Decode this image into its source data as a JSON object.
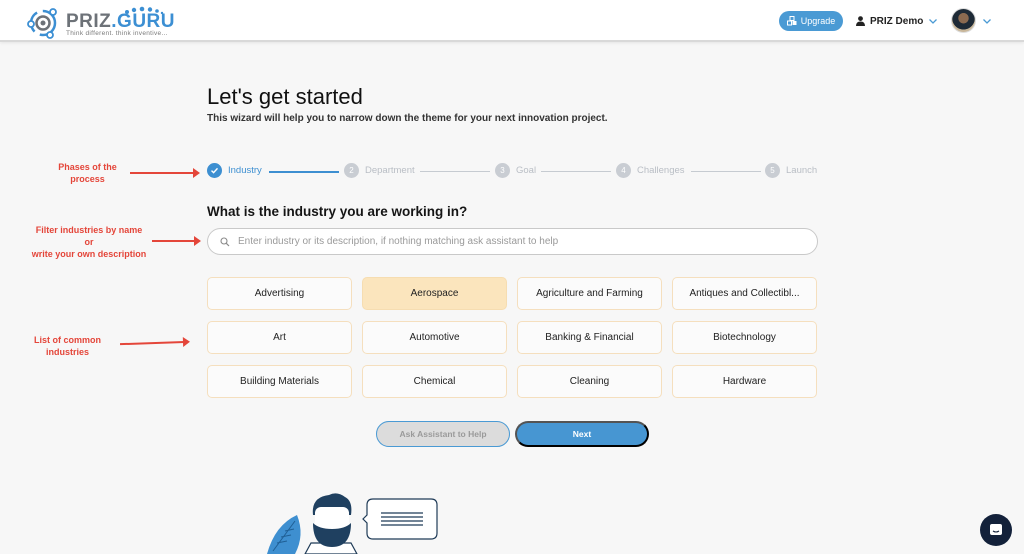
{
  "header": {
    "logo": {
      "brand_part1": "PRIZ",
      "brand_part2": ".GURU",
      "tagline": "Think different. think inventive..."
    },
    "upgrade_label": "Upgrade",
    "user_name": "PRIZ Demo",
    "icons": {
      "upgrade": "cubes-icon",
      "user": "user-icon",
      "chevron": "chevron-down-icon",
      "avatar": "avatar"
    }
  },
  "page": {
    "title": "Let's get started",
    "subtitle": "This wizard will help you to narrow down the theme for your next innovation project."
  },
  "stepper": {
    "steps": [
      {
        "number": "✓",
        "label": "Industry",
        "state": "active"
      },
      {
        "number": "2",
        "label": "Department",
        "state": "inactive"
      },
      {
        "number": "3",
        "label": "Goal",
        "state": "inactive"
      },
      {
        "number": "4",
        "label": "Challenges",
        "state": "inactive"
      },
      {
        "number": "5",
        "label": "Launch",
        "state": "inactive"
      }
    ]
  },
  "question": "What is the industry you are working in?",
  "search": {
    "value": "",
    "placeholder": "Enter industry or its description, if nothing matching ask assistant to help"
  },
  "industries": [
    {
      "label": "Advertising",
      "selected": false
    },
    {
      "label": "Aerospace",
      "selected": true
    },
    {
      "label": "Agriculture and Farming",
      "selected": false
    },
    {
      "label": "Antiques and Collectibl...",
      "selected": false
    },
    {
      "label": "Art",
      "selected": false
    },
    {
      "label": "Automotive",
      "selected": false
    },
    {
      "label": "Banking & Financial",
      "selected": false
    },
    {
      "label": "Biotechnology",
      "selected": false
    },
    {
      "label": "Building Materials",
      "selected": false
    },
    {
      "label": "Chemical",
      "selected": false
    },
    {
      "label": "Cleaning",
      "selected": false
    },
    {
      "label": "Hardware",
      "selected": false
    }
  ],
  "buttons": {
    "ask_assistant": "Ask Assistant to Help",
    "next": "Next"
  },
  "annotations": {
    "phases_line1": "Phases of the",
    "phases_line2": "process",
    "filter_line1": "Filter industries by name",
    "filter_line2": "or",
    "filter_line3": "write your own description",
    "list_line1": "List of common",
    "list_line2": "industries"
  },
  "colors": {
    "accent": "#4796d2",
    "selected_chip": "#fbe5bd",
    "chip_border": "#f5dfbe",
    "annotation": "#e4463a",
    "chat_fab": "#13213a"
  }
}
